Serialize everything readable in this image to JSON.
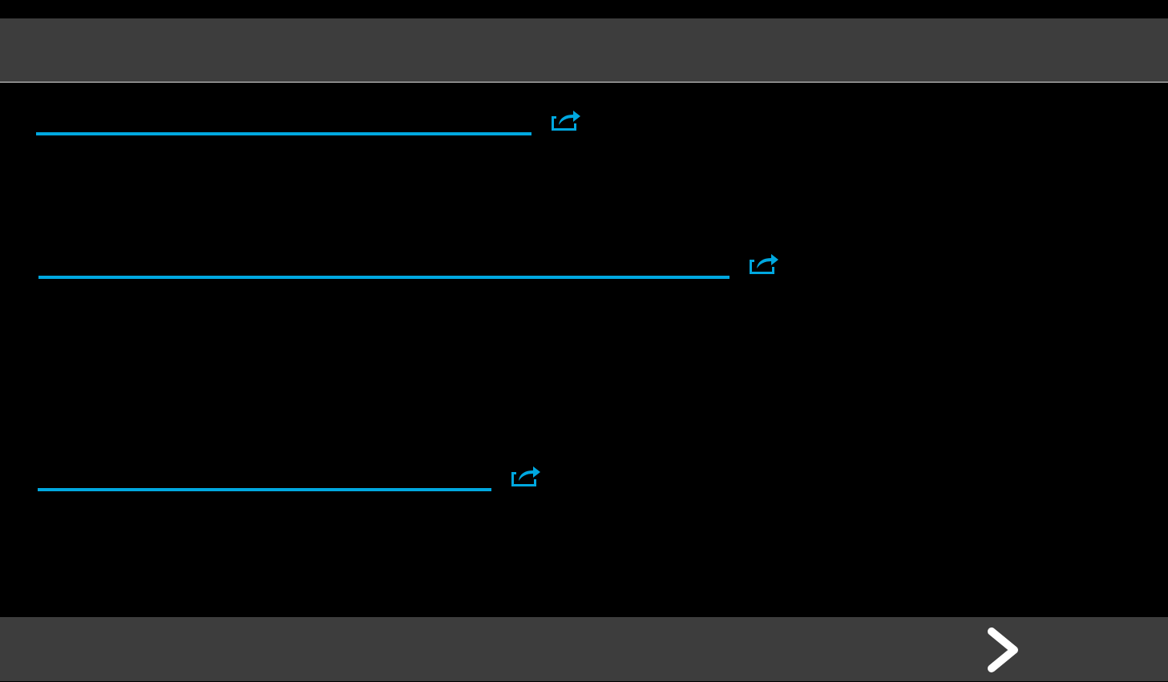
{
  "links": [
    {
      "kind": "external"
    },
    {
      "kind": "external"
    },
    {
      "kind": "external"
    }
  ],
  "bottom_bar": {
    "next": true
  }
}
